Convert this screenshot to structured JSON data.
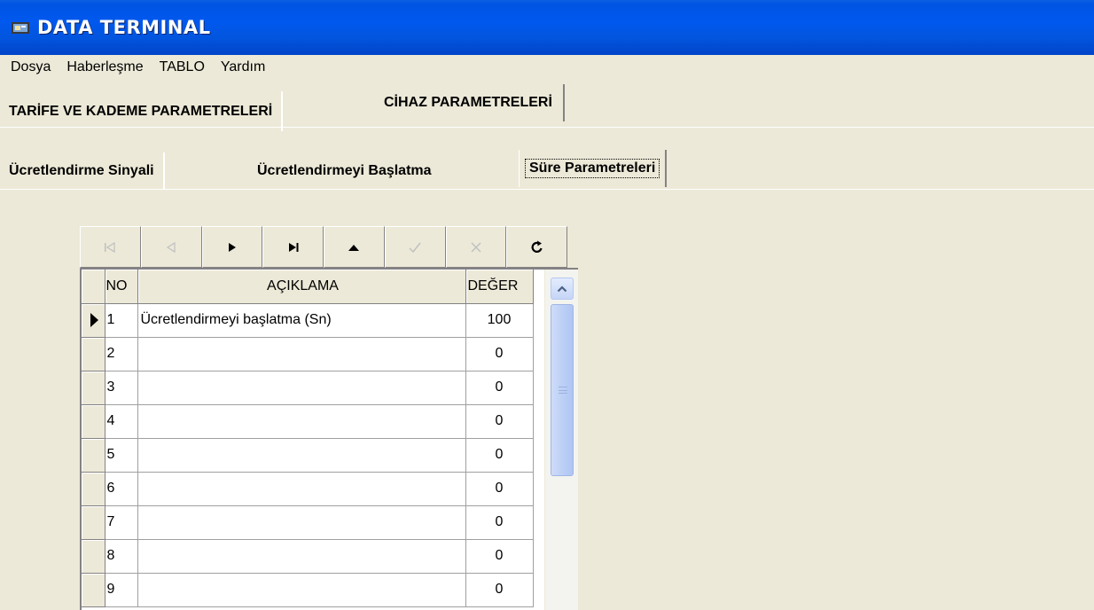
{
  "window": {
    "title": "DATA TERMINAL"
  },
  "menu": [
    "Dosya",
    "Haberleşme",
    "TABLO",
    "Yardım"
  ],
  "main_tabs": [
    "TARİFE VE KADEME PARAMETRELERİ",
    "CİHAZ PARAMETRELERİ"
  ],
  "sub_tabs": [
    "Ücretlendirme Sinyali",
    "Ücretlendirmeyi Başlatma",
    "Süre Parametreleri"
  ],
  "grid": {
    "columns": [
      "NO",
      "AÇIKLAMA",
      "DEĞER"
    ],
    "rows": [
      {
        "no": "1",
        "desc": "Ücretlendirmeyi başlatma (Sn)",
        "val": "100"
      },
      {
        "no": "2",
        "desc": "",
        "val": "0"
      },
      {
        "no": "3",
        "desc": "",
        "val": "0"
      },
      {
        "no": "4",
        "desc": "",
        "val": "0"
      },
      {
        "no": "5",
        "desc": "",
        "val": "0"
      },
      {
        "no": "6",
        "desc": "",
        "val": "0"
      },
      {
        "no": "7",
        "desc": "",
        "val": "0"
      },
      {
        "no": "8",
        "desc": "",
        "val": "0"
      },
      {
        "no": "9",
        "desc": "",
        "val": "0"
      }
    ]
  },
  "colors": {
    "titlebar": "#0054e3",
    "face": "#ece9d8"
  }
}
